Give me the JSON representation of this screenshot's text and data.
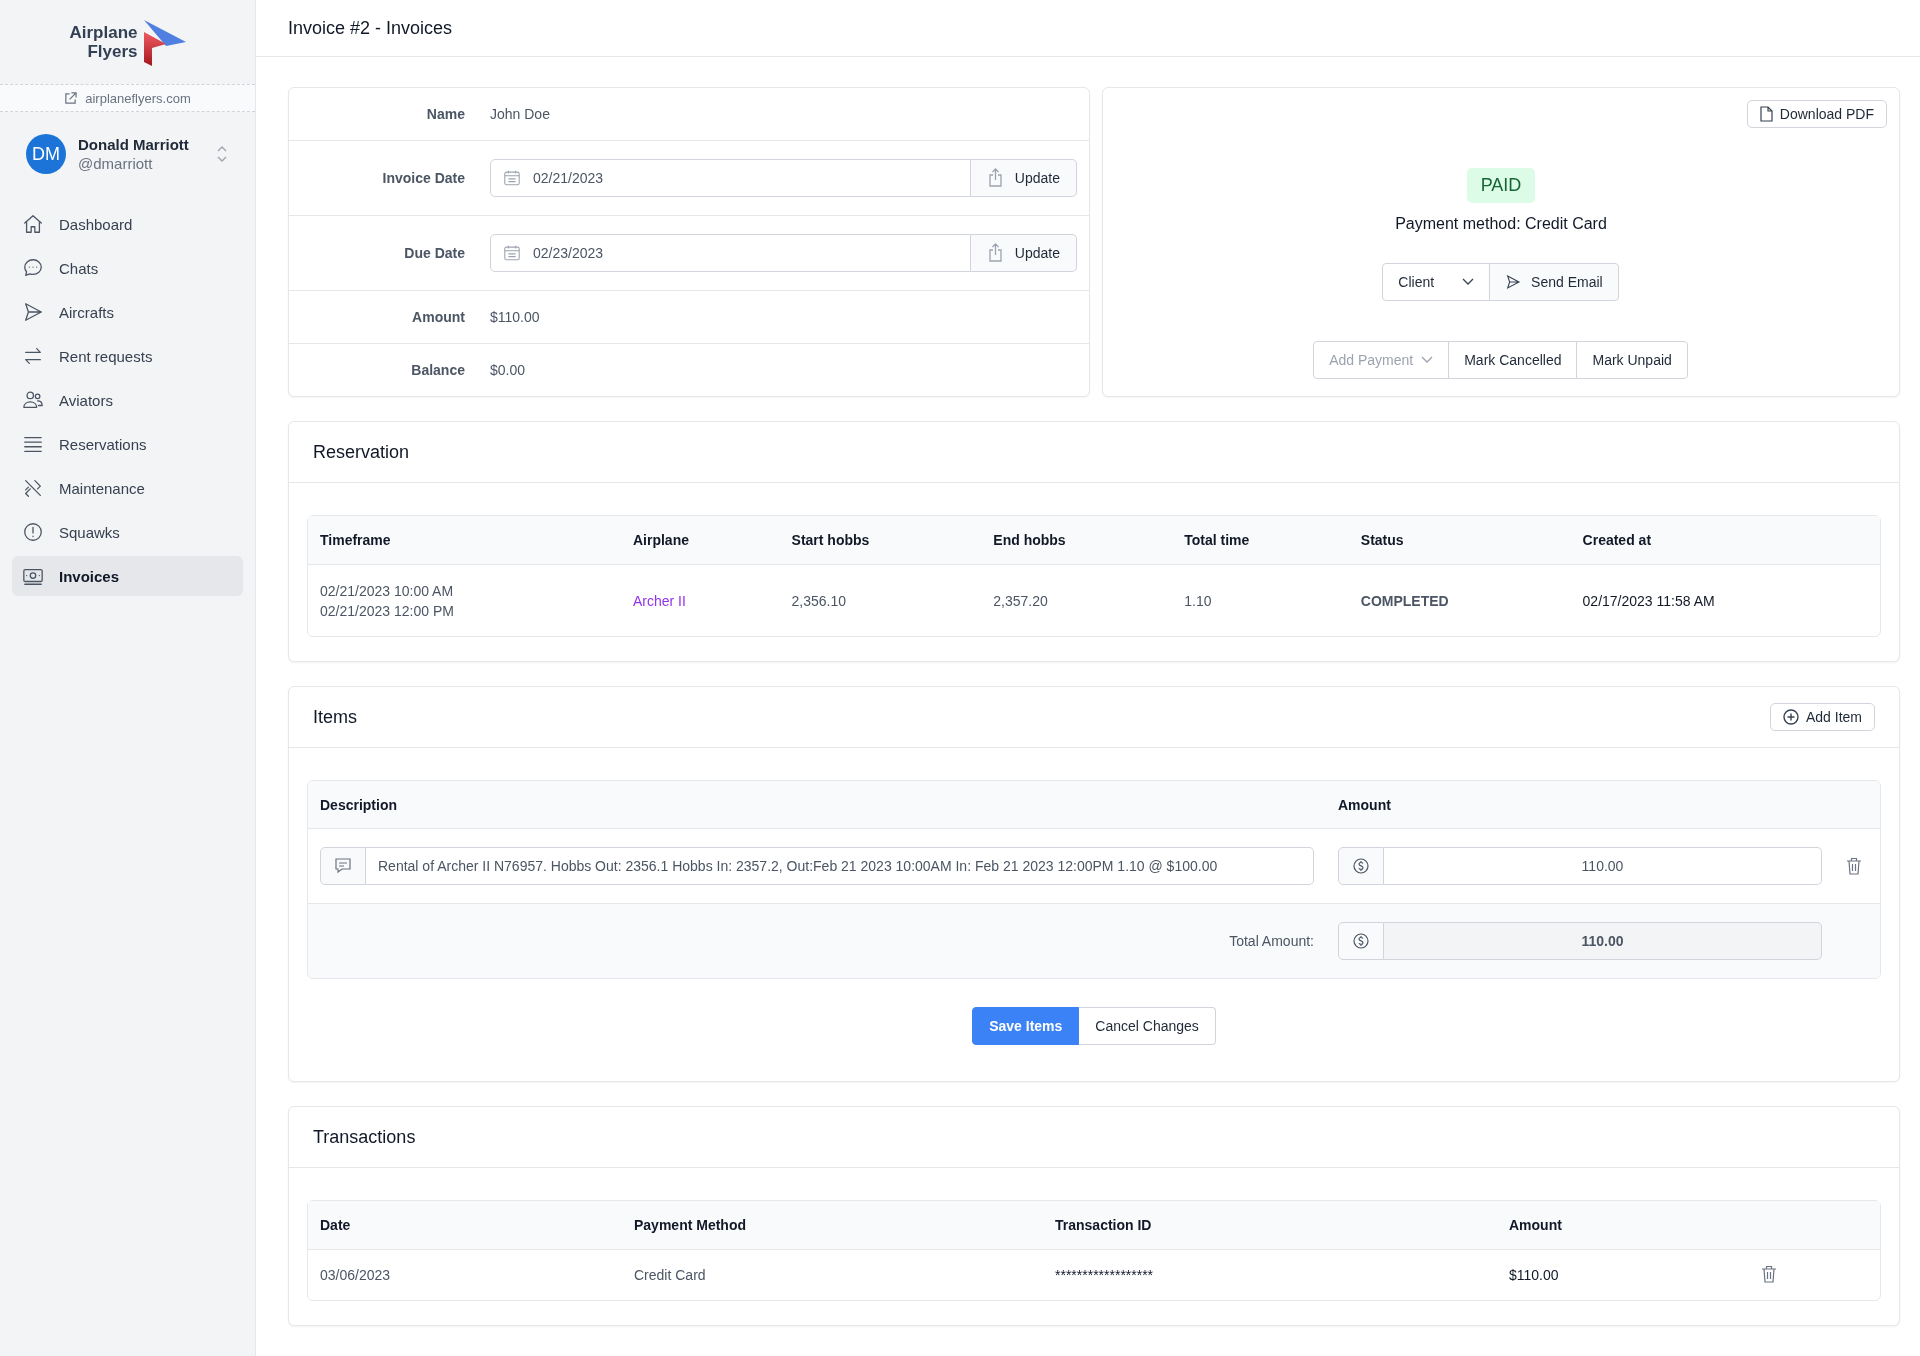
{
  "sidebar": {
    "logo": {
      "line1": "Airplane",
      "line2": "Flyers"
    },
    "site_link": "airplaneflyers.com",
    "user": {
      "initials": "DM",
      "name": "Donald Marriott",
      "handle": "@dmarriott"
    },
    "items": [
      {
        "label": "Dashboard",
        "selected": false
      },
      {
        "label": "Chats",
        "selected": false
      },
      {
        "label": "Aircrafts",
        "selected": false
      },
      {
        "label": "Rent requests",
        "selected": false
      },
      {
        "label": "Aviators",
        "selected": false
      },
      {
        "label": "Reservations",
        "selected": false
      },
      {
        "label": "Maintenance",
        "selected": false
      },
      {
        "label": "Squawks",
        "selected": false
      },
      {
        "label": "Invoices",
        "selected": true
      }
    ]
  },
  "header": {
    "title": "Invoice #2 - Invoices"
  },
  "invoice_form": [
    {
      "kind": "text",
      "label": "Name",
      "value": "John Doe"
    },
    {
      "kind": "date",
      "label": "Invoice Date",
      "value": "02/21/2023",
      "button": "Update"
    },
    {
      "kind": "date",
      "label": "Due Date",
      "value": "02/23/2023",
      "button": "Update"
    },
    {
      "kind": "text",
      "label": "Amount",
      "value": "$110.00"
    },
    {
      "kind": "text",
      "label": "Balance",
      "value": "$0.00"
    }
  ],
  "status_card": {
    "download_button": "Download PDF",
    "status": "PAID",
    "payment_method": "Payment method: Credit Card",
    "recipient_select": "Client",
    "send_button": "Send Email",
    "actions": [
      {
        "kind": "dropdown",
        "label": "Add Payment",
        "disabled": true
      },
      {
        "kind": "button",
        "label": "Mark Cancelled",
        "disabled": false
      },
      {
        "kind": "button",
        "label": "Mark Unpaid",
        "disabled": false
      }
    ]
  },
  "reservation": {
    "title": "Reservation",
    "columns": [
      "Timeframe",
      "Airplane",
      "Start hobbs",
      "End hobbs",
      "Total time",
      "Status",
      "Created at"
    ],
    "rows": [
      {
        "timeframe": [
          "02/21/2023 10:00 AM",
          "02/21/2023 12:00 PM"
        ],
        "airplane": "Archer II",
        "start_hobbs": "2,356.10",
        "end_hobbs": "2,357.20",
        "total_time": "1.10",
        "status": "COMPLETED",
        "created_at": "02/17/2023 11:58 AM"
      }
    ]
  },
  "items": {
    "title": "Items",
    "add_button": "Add Item",
    "columns": [
      "Description",
      "Amount"
    ],
    "rows": [
      {
        "description": "Rental of Archer II N76957. Hobbs Out: 2356.1 Hobbs In: 2357.2, Out:Feb 21 2023 10:00AM In: Feb 21 2023 12:00PM 1.10 @ $100.00",
        "amount": "110.00"
      }
    ],
    "total_label": "Total Amount:",
    "total": "110.00",
    "save_button": "Save Items",
    "cancel_button": "Cancel Changes"
  },
  "transactions": {
    "title": "Transactions",
    "columns": [
      "Date",
      "Payment Method",
      "Transaction ID",
      "Amount"
    ],
    "rows": [
      {
        "date": "03/06/2023",
        "payment_method": "Credit Card",
        "transaction_id": "******************",
        "amount": "$110.00"
      }
    ]
  }
}
